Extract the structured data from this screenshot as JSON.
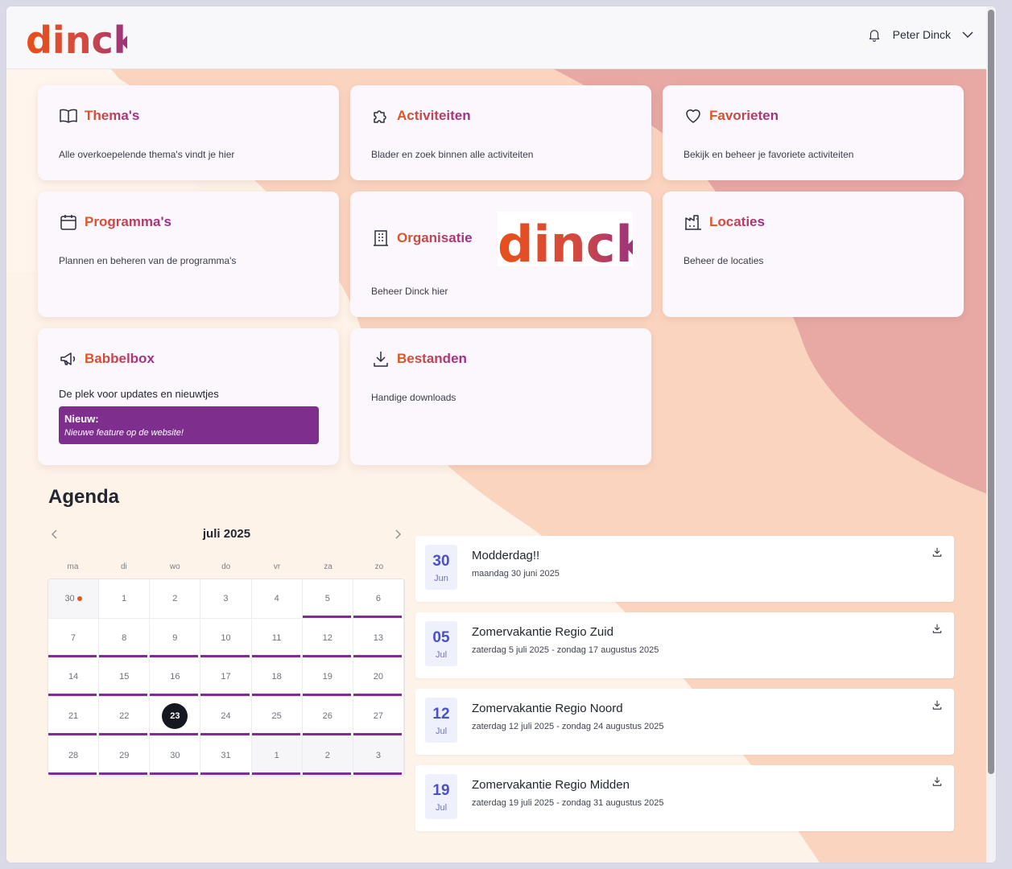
{
  "colors": {
    "brand_orange": "#e2561f",
    "brand_purple": "#7e2f8e",
    "accent_blue": "#4a50c8"
  },
  "header": {
    "logo_text": "dinck",
    "user_name": "Peter Dinck"
  },
  "cards": {
    "themas": {
      "title": "Thema's",
      "desc": "Alle overkoepelende thema's vindt je hier",
      "icon": "book-icon"
    },
    "activiteiten": {
      "title": "Activiteiten",
      "desc": "Blader en zoek binnen alle activiteiten",
      "icon": "puzzle-icon"
    },
    "favorieten": {
      "title": "Favorieten",
      "desc": "Bekijk en beheer je favoriete activiteiten",
      "icon": "heart-icon"
    },
    "programmas": {
      "title": "Programma's",
      "desc": "Plannen en beheren van de programma's",
      "icon": "calendar-icon"
    },
    "organisatie": {
      "title": "Organisatie",
      "desc": "Beheer Dinck hier",
      "icon": "building-icon",
      "logo_text": "dinck"
    },
    "locaties": {
      "title": "Locaties",
      "desc": "Beheer de locaties",
      "icon": "factory-icon"
    },
    "babbelbox": {
      "title": "Babbelbox",
      "desc": "De plek voor updates en nieuwtjes",
      "icon": "megaphone-icon",
      "news_title": "Nieuw:",
      "news_text": "Nieuwe feature op de website!"
    },
    "bestanden": {
      "title": "Bestanden",
      "desc": "Handige downloads",
      "icon": "download-icon"
    }
  },
  "agenda": {
    "title": "Agenda",
    "month": "juli 2025",
    "weekdays": [
      "ma",
      "di",
      "wo",
      "do",
      "vr",
      "za",
      "zo"
    ],
    "days": [
      {
        "d": "30",
        "other": true,
        "dot": true,
        "bar": false
      },
      {
        "d": "1",
        "other": false,
        "bar": false
      },
      {
        "d": "2",
        "other": false,
        "bar": false
      },
      {
        "d": "3",
        "other": false,
        "bar": false
      },
      {
        "d": "4",
        "other": false,
        "bar": false
      },
      {
        "d": "5",
        "other": false,
        "bar": true
      },
      {
        "d": "6",
        "other": false,
        "bar": true
      },
      {
        "d": "7",
        "bar": true
      },
      {
        "d": "8",
        "bar": true
      },
      {
        "d": "9",
        "bar": true
      },
      {
        "d": "10",
        "bar": true
      },
      {
        "d": "11",
        "bar": true
      },
      {
        "d": "12",
        "bar": true
      },
      {
        "d": "13",
        "bar": true
      },
      {
        "d": "14",
        "bar": true
      },
      {
        "d": "15",
        "bar": true
      },
      {
        "d": "16",
        "bar": true
      },
      {
        "d": "17",
        "bar": true
      },
      {
        "d": "18",
        "bar": true
      },
      {
        "d": "19",
        "bar": true
      },
      {
        "d": "20",
        "bar": true
      },
      {
        "d": "21",
        "bar": true
      },
      {
        "d": "22",
        "bar": true
      },
      {
        "d": "23",
        "bar": true,
        "today": true
      },
      {
        "d": "24",
        "bar": true
      },
      {
        "d": "25",
        "bar": true
      },
      {
        "d": "26",
        "bar": true
      },
      {
        "d": "27",
        "bar": true
      },
      {
        "d": "28",
        "bar": true
      },
      {
        "d": "29",
        "bar": true
      },
      {
        "d": "30",
        "bar": true
      },
      {
        "d": "31",
        "bar": true
      },
      {
        "d": "1",
        "other": true,
        "bar": true
      },
      {
        "d": "2",
        "other": true,
        "bar": true
      },
      {
        "d": "3",
        "other": true,
        "bar": true
      }
    ],
    "events": [
      {
        "day": "30",
        "month": "Jun",
        "title": "Modderdag!!",
        "sub": "maandag 30 juni 2025"
      },
      {
        "day": "05",
        "month": "Jul",
        "title": "Zomervakantie Regio Zuid",
        "sub": "zaterdag 5 juli 2025 - zondag 17 augustus 2025"
      },
      {
        "day": "12",
        "month": "Jul",
        "title": "Zomervakantie Regio Noord",
        "sub": "zaterdag 12 juli 2025 - zondag 24 augustus 2025"
      },
      {
        "day": "19",
        "month": "Jul",
        "title": "Zomervakantie Regio Midden",
        "sub": "zaterdag 19 juli 2025 - zondag 31 augustus 2025"
      }
    ]
  }
}
